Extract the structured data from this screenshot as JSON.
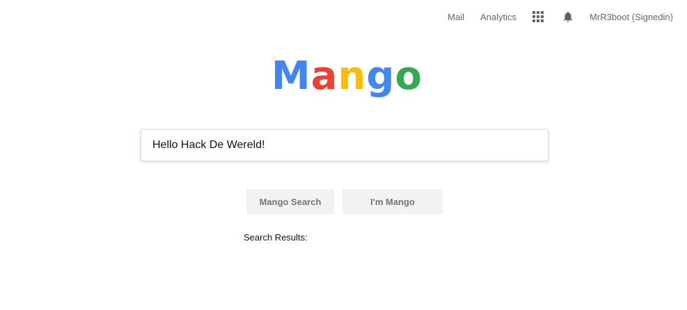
{
  "header": {
    "mail_label": "Mail",
    "analytics_label": "Analytics",
    "apps_icon": "apps-grid-icon",
    "notifications_icon": "bell-icon",
    "user_label": "MrR3boot (Signedin)"
  },
  "logo": {
    "letters": [
      {
        "char": "M",
        "color": "#4285f4"
      },
      {
        "char": "a",
        "color": "#ea4335"
      },
      {
        "char": "n",
        "color": "#fbbc05"
      },
      {
        "char": "g",
        "color": "#4285f4"
      },
      {
        "char": "o",
        "color": "#34a853"
      }
    ]
  },
  "search": {
    "value": "Hello Hack De Wereld!",
    "placeholder": ""
  },
  "buttons": {
    "search_label": "Mango Search",
    "lucky_label": "I'm Mango"
  },
  "results": {
    "label": "Search Results:"
  }
}
